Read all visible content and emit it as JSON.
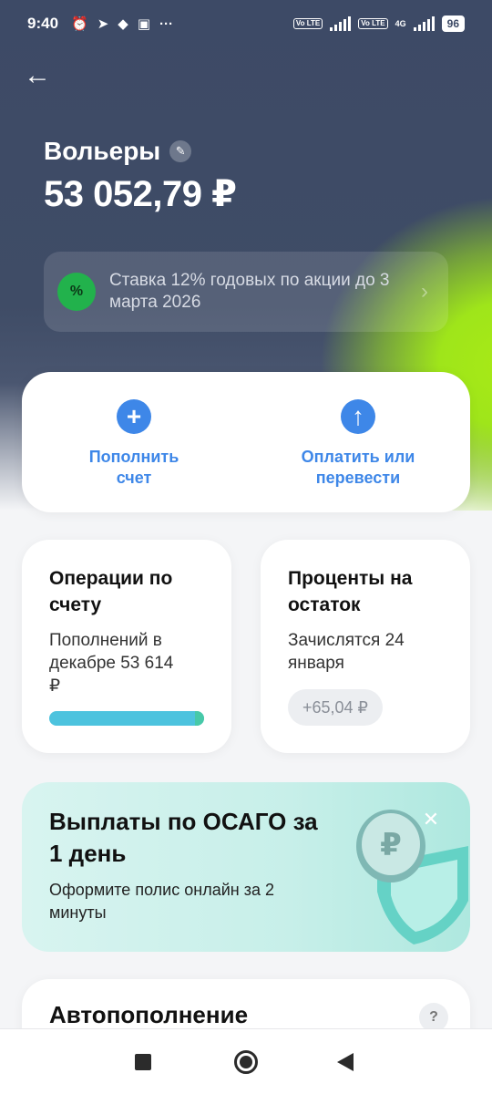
{
  "status_bar": {
    "time": "9:40",
    "icons": [
      "alarm-icon",
      "telegram-icon",
      "dropbox-icon",
      "app-icon",
      "more-icon"
    ],
    "network_1": "Vo LTE",
    "network_2": "Vo LTE",
    "network_type": "4G",
    "battery": "96"
  },
  "header": {
    "account_name": "Вольеры",
    "balance": "53 052,79 ₽"
  },
  "promo": {
    "text": "Ставка 12% годовых по акции до 3 марта 2026",
    "badge_symbol": "%"
  },
  "actions": [
    {
      "label": "Пополнить счет",
      "icon": "plus-icon"
    },
    {
      "label": "Оплатить или перевести",
      "icon": "arrow-up-icon"
    }
  ],
  "operations_card": {
    "title": "Операции по счету",
    "subtitle": "Пополнений в декабре 53 614 ₽"
  },
  "interest_card": {
    "title": "Проценты на остаток",
    "subtitle": "Зачислятся 24 января",
    "amount": "+65,04 ₽"
  },
  "banner": {
    "title": "Выплаты по ОСАГО за 1 день",
    "subtitle": "Оформите полис онлайн за 2 минуты",
    "close": "✕"
  },
  "autofill": {
    "title": "Автопополнение",
    "help": "?"
  }
}
